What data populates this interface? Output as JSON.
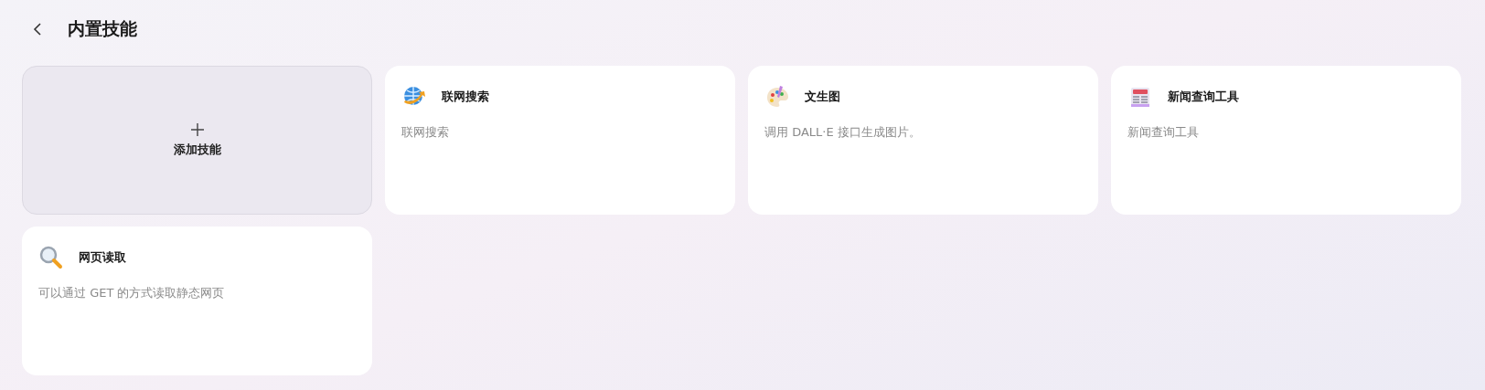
{
  "header": {
    "title": "内置技能"
  },
  "add_card": {
    "label": "添加技能"
  },
  "skills": [
    {
      "kind": "globe",
      "name": "联网搜索",
      "description": "联网搜索"
    },
    {
      "kind": "palette",
      "name": "文生图",
      "description": "调用 DALL·E 接口生成图片。"
    },
    {
      "kind": "news",
      "name": "新闻查询工具",
      "description": "新闻查询工具"
    },
    {
      "kind": "magnifier",
      "name": "网页读取",
      "description": "可以通过 GET 的方式读取静态网页"
    }
  ]
}
